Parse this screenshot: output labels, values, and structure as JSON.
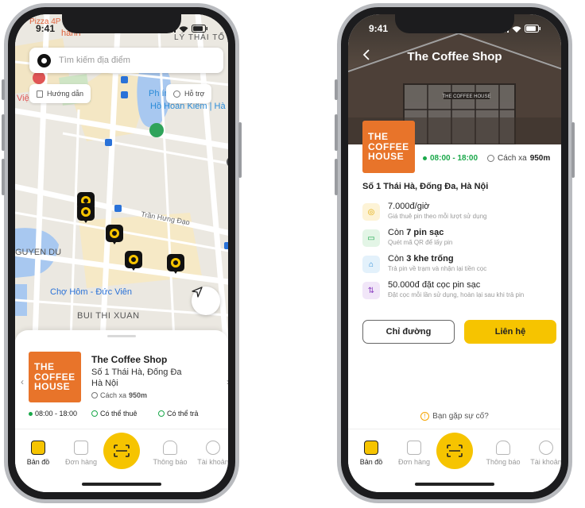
{
  "status": {
    "time_left": "9:41",
    "time_right": "9:41"
  },
  "map_screen": {
    "search_placeholder": "Tìm kiếm địa điểm",
    "guide_chip": "Hướng dẫn",
    "support_chip": "Hỗ trợ",
    "labels": {
      "pizza": "Pizza 4P",
      "hanh": "hanh",
      "ly_thai_to": "LÝ THÁI TỔ",
      "viet": "Việ",
      "lake_1": "Ph      ím -",
      "lake_2": "Hồ Hoàn Kiếm | Hà N",
      "tran_hung_dao": "Trần Hưng Đạo",
      "nguyen_du": "GUYEN DU",
      "cho_hom": "Chợ Hôm - Đức Viên",
      "bui_thi_xuan": "BUI THI XUAN"
    },
    "card": {
      "logo_lines": [
        "THE",
        "COFFEE",
        "HOUSE"
      ],
      "name": "The Coffee Shop",
      "address": "Số 1 Thái Hà, Đống Đa Hà Nội",
      "distance_prefix": "Cách xa",
      "distance": "950m",
      "hours": "08:00 - 18:00",
      "rent": "Có thể thuê",
      "return": "Có thể trả"
    }
  },
  "tabs": [
    {
      "label": "Bản đồ",
      "icon": "map-icon"
    },
    {
      "label": "Đơn hàng",
      "icon": "orders-icon"
    },
    {
      "label": "Thông báo",
      "icon": "bell-icon"
    },
    {
      "label": "Tài khoản",
      "icon": "account-icon"
    }
  ],
  "detail_screen": {
    "title": "The Coffee Shop",
    "hero_sign": "THE COFFEE HOUSE",
    "logo_lines": [
      "THE",
      "COFFEE",
      "HOUSE"
    ],
    "hours": "08:00 - 18:00",
    "distance_prefix": "Cách xa",
    "distance": "950m",
    "address": "Số 1 Thái Hà, Đống Đa, Hà Nội",
    "info": [
      {
        "title": "7.000đ/giờ",
        "sub": "Giá thuê pin theo mỗi lượt sử dụng",
        "icon": "coin-icon",
        "bg": "#fdf3d6",
        "fg": "#e0a800"
      },
      {
        "title_pre": "Còn ",
        "title_bold": "7 pin sạc",
        "sub": "Quét mã QR để lấy pin",
        "icon": "battery-icon",
        "bg": "#e3f5e6",
        "fg": "#1aa84a"
      },
      {
        "title_pre": "Còn ",
        "title_bold": "3 khe trống",
        "sub": "Trả pin về trạm và nhận lại tiền cọc",
        "icon": "slot-icon",
        "bg": "#e3f1fb",
        "fg": "#2a8bd8"
      },
      {
        "title": "50.000đ đặt cọc pin sạc",
        "sub": "Đặt cọc mỗi lần sử dụng, hoàn lại sau khi trả pin",
        "icon": "transfer-icon",
        "bg": "#f1e6f8",
        "fg": "#8a3fc0"
      }
    ],
    "directions_btn": "Chỉ đường",
    "contact_btn": "Liên hệ",
    "problem_link": "Bạn gặp sự cố?"
  },
  "colors": {
    "accent": "#f6c400",
    "brand_orange": "#e8742a",
    "green": "#1aa84a"
  }
}
